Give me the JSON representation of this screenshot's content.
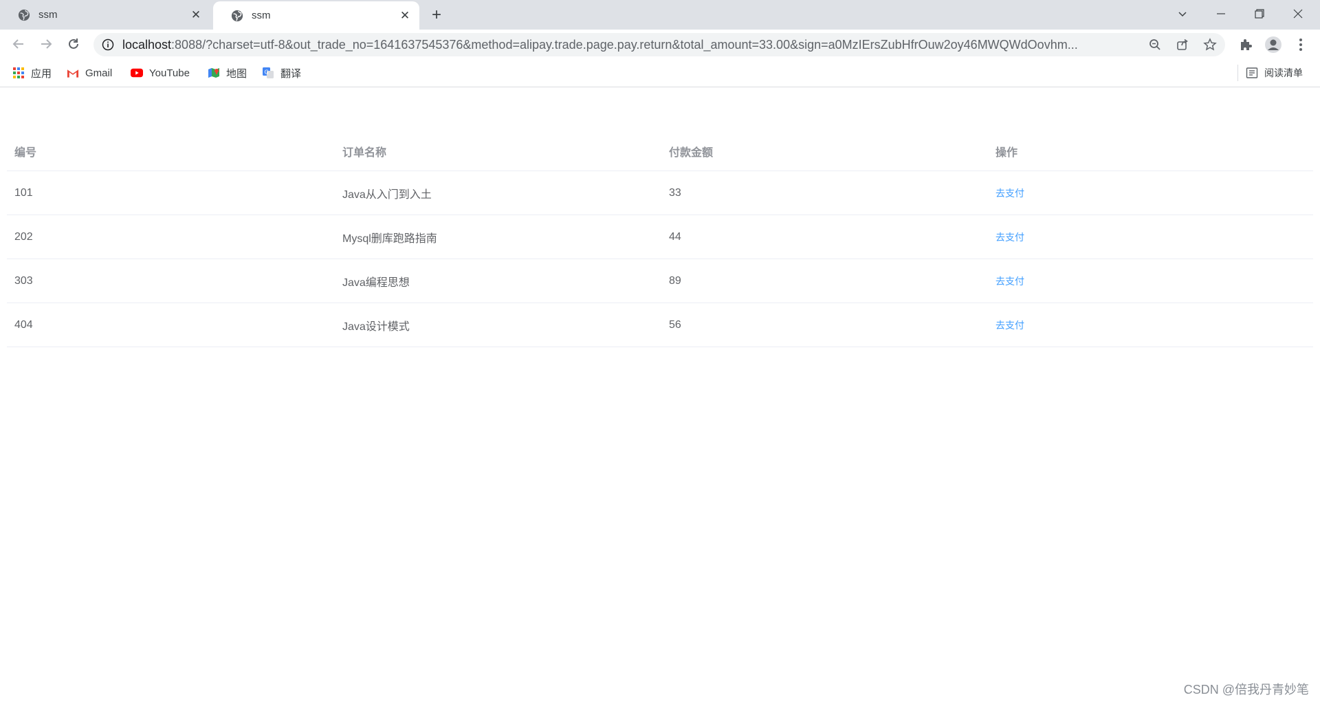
{
  "browser": {
    "tabs": [
      {
        "title": "ssm",
        "active": false
      },
      {
        "title": "ssm",
        "active": true
      }
    ],
    "new_tab": "+",
    "window_controls": [
      "chevron-down",
      "minimize",
      "restore",
      "close"
    ],
    "url_host": "localhost",
    "url_rest": ":8088/?charset=utf-8&out_trade_no=1641637545376&method=alipay.trade.page.pay.return&total_amount=33.00&sign=a0MzIErsZubHfrOuw2oy46MWQWdOovhm...",
    "bookmarks": [
      {
        "label": "应用",
        "icon": "apps-grid-icon"
      },
      {
        "label": "Gmail",
        "icon": "gmail-icon"
      },
      {
        "label": "YouTube",
        "icon": "youtube-icon"
      },
      {
        "label": "地图",
        "icon": "maps-icon"
      },
      {
        "label": "翻译",
        "icon": "translate-icon"
      }
    ],
    "reading_list": "阅读清单"
  },
  "table": {
    "headers": [
      "编号",
      "订单名称",
      "付款金额",
      "操作"
    ],
    "rows": [
      {
        "id": "101",
        "name": "Java从入门到入土",
        "amount": "33",
        "action": "去支付"
      },
      {
        "id": "202",
        "name": "Mysql删库跑路指南",
        "amount": "44",
        "action": "去支付"
      },
      {
        "id": "303",
        "name": "Java编程思想",
        "amount": "89",
        "action": "去支付"
      },
      {
        "id": "404",
        "name": "Java设计模式",
        "amount": "56",
        "action": "去支付"
      }
    ]
  },
  "watermark": "CSDN @倍我丹青妙笔",
  "colors": {
    "link": "#409eff",
    "header_text": "#909399",
    "cell_text": "#606266",
    "row_border": "#ebeef5"
  }
}
